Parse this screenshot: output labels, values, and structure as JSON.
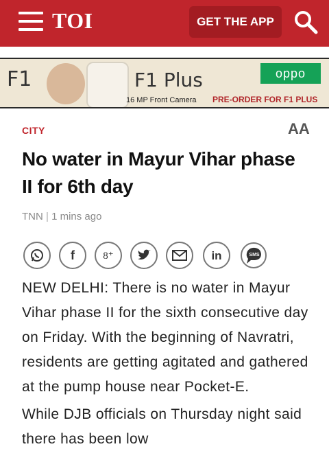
{
  "header": {
    "logo": "TOI",
    "get_app_label": "GET THE APP"
  },
  "ad": {
    "model": "F1",
    "model_plus": "F1 Plus",
    "brand": "oppo",
    "feature": "16 MP Front Camera",
    "cta": "PRE-ORDER FOR F1 PLUS"
  },
  "article": {
    "section": "CITY",
    "font_toggle": "AA",
    "headline": "No water in Mayur Vihar phase II for 6th day",
    "source": "TNN",
    "time": "1 mins ago",
    "paragraphs": [
      "NEW DELHI: There is no water in Mayur Vihar phase II for the sixth consecutive day on Friday. With the beginning of Navratri, residents are getting agitated and gathered at the pump house near Pocket-E.",
      "While DJB officials on Thursday night said there has been low"
    ]
  },
  "share": {
    "icons": [
      "whatsapp-icon",
      "facebook-icon",
      "google-plus-icon",
      "twitter-icon",
      "email-icon",
      "linkedin-icon",
      "sms-icon"
    ]
  },
  "colors": {
    "brand_red": "#c0252c",
    "button_red": "#a31c22",
    "oppo_green": "#15a257"
  }
}
